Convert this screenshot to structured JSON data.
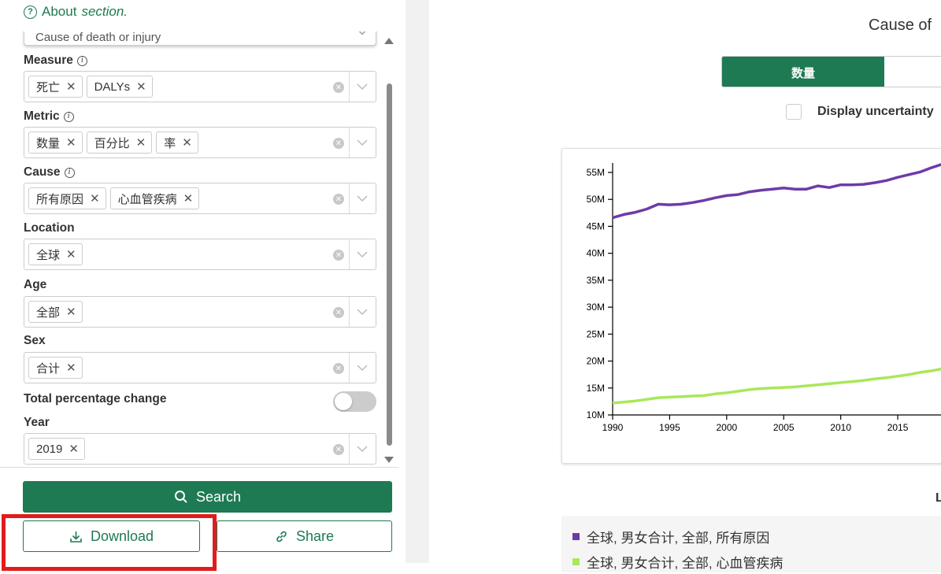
{
  "about": {
    "prefix": "About",
    "suffix": "section."
  },
  "top_select": {
    "value": "Cause of death or injury"
  },
  "fields": {
    "measure": {
      "label": "Measure",
      "tags": [
        "死亡",
        "DALYs"
      ]
    },
    "metric": {
      "label": "Metric",
      "tags": [
        "数量",
        "百分比",
        "率"
      ]
    },
    "cause": {
      "label": "Cause",
      "tags": [
        "所有原因",
        "心血管疾病"
      ]
    },
    "location": {
      "label": "Location",
      "tags": [
        "全球"
      ]
    },
    "age": {
      "label": "Age",
      "tags": [
        "全部"
      ]
    },
    "sex": {
      "label": "Sex",
      "tags": [
        "合计"
      ]
    },
    "total_change": {
      "label": "Total percentage change",
      "enabled": false
    },
    "year": {
      "label": "Year",
      "tags": [
        "2019"
      ]
    }
  },
  "buttons": {
    "search": "Search",
    "download": "Download",
    "share": "Share"
  },
  "chart_panel": {
    "title": "Cause of",
    "tabs": [
      "数量"
    ],
    "uncertainty_label": "Display uncertainty",
    "legend_heading": "L",
    "legend": [
      {
        "label": "全球, 男女合计, 全部, 所有原因",
        "color": "#6f3aa8"
      },
      {
        "label": "全球, 男女合计, 全部, 心血管疾病",
        "color": "#a8e85a"
      }
    ]
  },
  "colors": {
    "accent": "#1e7a52",
    "highlight": "#e21c1c"
  },
  "chart_data": {
    "type": "line",
    "title": "",
    "xlabel": "",
    "ylabel": "",
    "xlim": [
      1990,
      2019
    ],
    "ylim": [
      10,
      55
    ],
    "x_ticks": [
      1990,
      1995,
      2000,
      2005,
      2010,
      2015
    ],
    "y_ticks": [
      "10M",
      "15M",
      "20M",
      "25M",
      "30M",
      "35M",
      "40M",
      "45M",
      "50M",
      "55M"
    ],
    "x": [
      1990,
      1991,
      1992,
      1993,
      1994,
      1995,
      1996,
      1997,
      1998,
      1999,
      2000,
      2001,
      2002,
      2003,
      2004,
      2005,
      2006,
      2007,
      2008,
      2009,
      2010,
      2011,
      2012,
      2013,
      2014,
      2015,
      2016,
      2017,
      2018,
      2019
    ],
    "series": [
      {
        "color": "#6f3aa8",
        "values": [
          46.6,
          47.2,
          47.6,
          48.2,
          49.1,
          49.0,
          49.1,
          49.4,
          49.8,
          50.3,
          50.7,
          50.9,
          51.4,
          51.7,
          51.9,
          52.1,
          51.9,
          51.9,
          52.5,
          52.2,
          52.7,
          52.7,
          52.8,
          53.1,
          53.5,
          54.1,
          54.6,
          55.1,
          55.9,
          56.6
        ]
      },
      {
        "color": "#a8e85a",
        "values": [
          12.2,
          12.4,
          12.6,
          12.9,
          13.2,
          13.3,
          13.4,
          13.5,
          13.6,
          13.9,
          14.1,
          14.4,
          14.7,
          14.9,
          15.0,
          15.1,
          15.2,
          15.4,
          15.6,
          15.8,
          16.0,
          16.2,
          16.4,
          16.7,
          16.9,
          17.2,
          17.5,
          17.9,
          18.2,
          18.6
        ]
      }
    ]
  }
}
